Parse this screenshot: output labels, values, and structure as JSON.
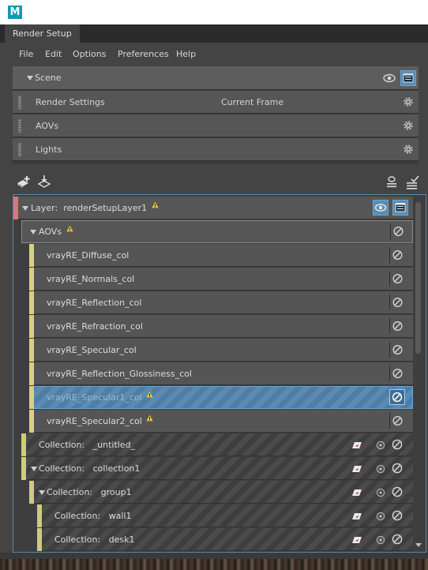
{
  "app": {
    "logo_letter": "M",
    "tab_title": "Render Setup"
  },
  "menu": [
    "File",
    "Edit",
    "Options",
    "Preferences",
    "Help"
  ],
  "scene": {
    "title": "Scene",
    "rows": [
      {
        "label": "Render Settings",
        "value": "Current Frame"
      },
      {
        "label": "AOVs",
        "value": ""
      },
      {
        "label": "Lights",
        "value": ""
      }
    ]
  },
  "layer": {
    "prefix": "Layer:",
    "name": "renderSetupLayer1"
  },
  "aovs": {
    "title": "AOVs",
    "items": [
      "vrayRE_Diffuse_col",
      "vrayRE_Normals_col",
      "vrayRE_Reflection_col",
      "vrayRE_Refraction_col",
      "vrayRE_Specular_col",
      "vrayRE_Reflection_Glossiness_col",
      "vrayRE_Specular1_col",
      "vrayRE_Specular2_col"
    ]
  },
  "collections": [
    {
      "prefix": "Collection:",
      "name": "_untitled_"
    },
    {
      "prefix": "Collection:",
      "name": "collection1"
    },
    {
      "prefix": "Collection:",
      "name": "group1"
    },
    {
      "prefix": "Collection:",
      "name": "wall1"
    },
    {
      "prefix": "Collection:",
      "name": "desk1"
    }
  ],
  "colors": {
    "accent_blue": "#5a8cb4",
    "layer_marker": "#d97878",
    "aov_marker": "#d6d37f",
    "collection_marker": "#cfcc7a",
    "warning": "#e8c340"
  }
}
